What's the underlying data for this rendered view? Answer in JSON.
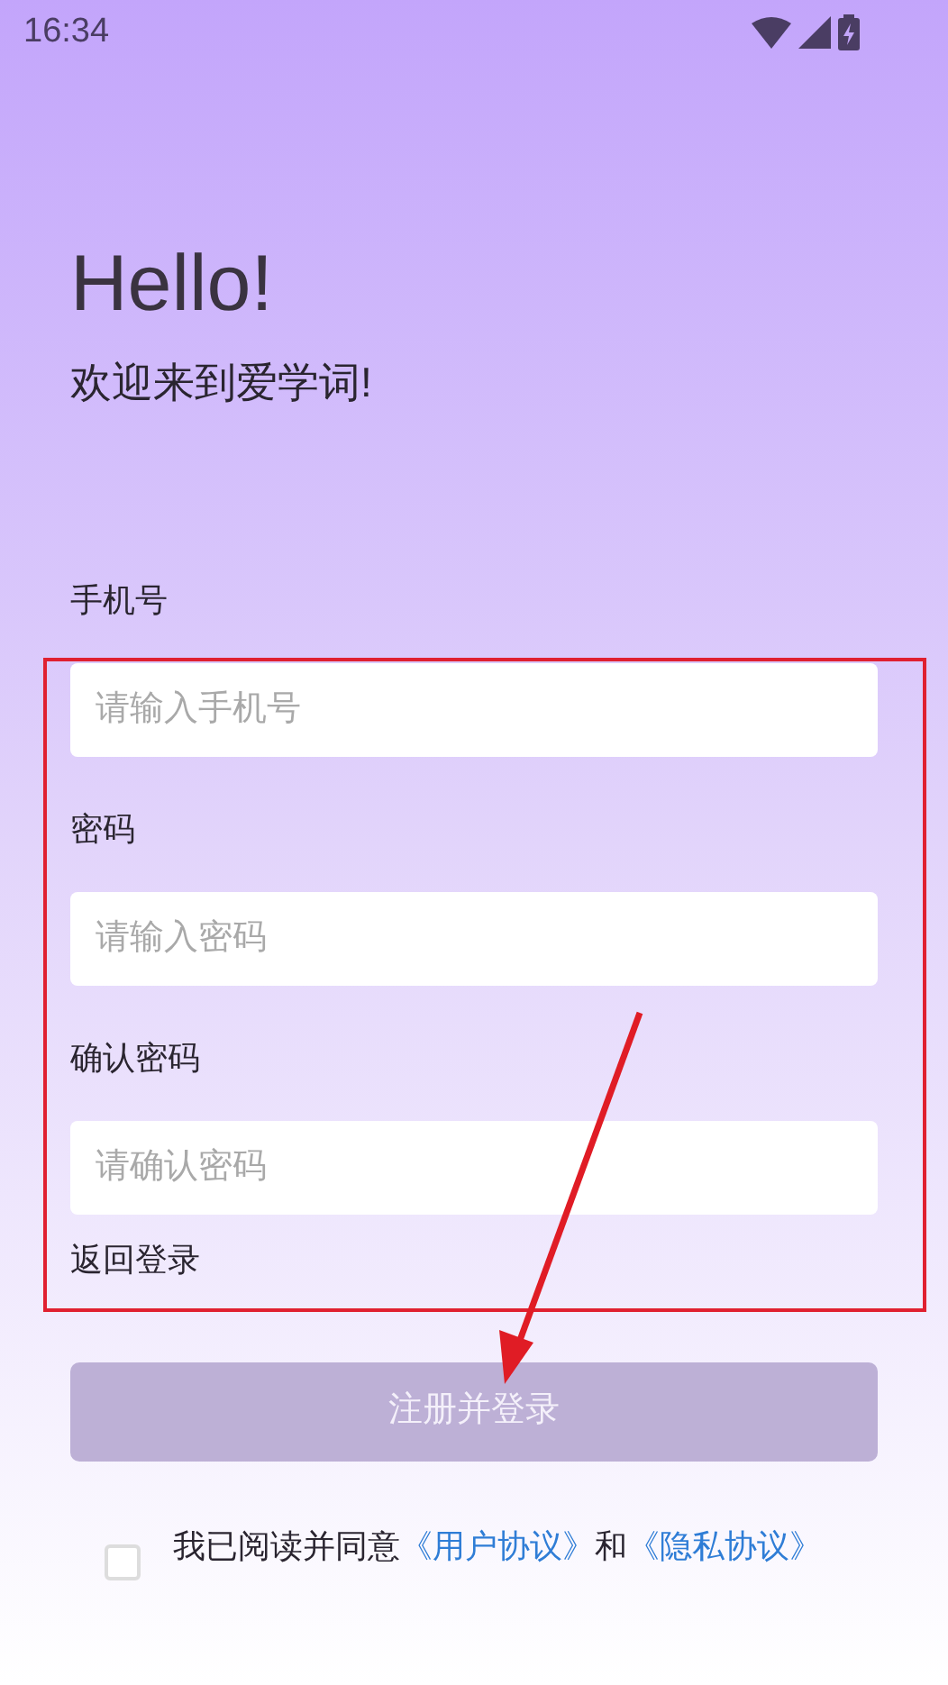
{
  "status_bar": {
    "time": "16:34"
  },
  "greeting": {
    "title": "Hello!",
    "subtitle": "欢迎来到爱学词!"
  },
  "fields": [
    {
      "label": "手机号",
      "placeholder": "请输入手机号"
    },
    {
      "label": "密码",
      "placeholder": "请输入密码"
    },
    {
      "label": "确认密码",
      "placeholder": "请确认密码"
    }
  ],
  "back_link": "返回登录",
  "submit_button": {
    "label": "注册并登录",
    "disabled": true
  },
  "agreement": {
    "checked": false,
    "text": "我已阅读并同意",
    "link_1": "《用户协议》",
    "joiner": "和",
    "link_2": "《隐私协议》"
  }
}
